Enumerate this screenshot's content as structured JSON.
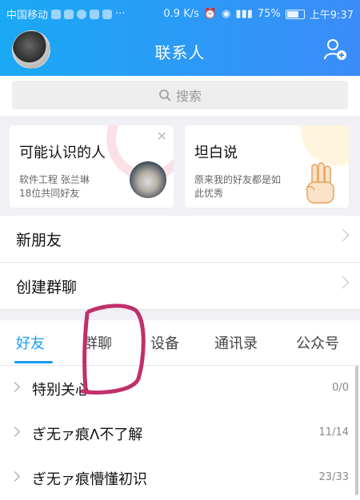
{
  "status_bar": {
    "carrier": "中国移动",
    "speed": "0.9 K/s",
    "battery": "75%",
    "time": "上午9:37"
  },
  "header": {
    "title": "联系人"
  },
  "search": {
    "placeholder": "搜索"
  },
  "cards": [
    {
      "title": "可能认识的人",
      "line1": "软件工程 张兰琳",
      "line2": "18位共同好友"
    },
    {
      "title": "坦白说",
      "line1": "原来我的好友都是如",
      "line2": "此优秀"
    }
  ],
  "menu": [
    {
      "label": "新朋友"
    },
    {
      "label": "创建群聊"
    }
  ],
  "tabs": [
    "好友",
    "群聊",
    "设备",
    "通讯录",
    "公众号"
  ],
  "groups": [
    {
      "name": "特别关心",
      "count": "0/0"
    },
    {
      "name": "ぎ无ァ痕Λ不了解",
      "count": "11/14"
    },
    {
      "name": "ぎ无ァ痕懵懂初识",
      "count": "23/33"
    }
  ],
  "colors": {
    "accent": "#1a9bf5",
    "header_start": "#1aa9f5",
    "header_end": "#3b8cf8",
    "annotation": "#c0306a"
  },
  "icons": {
    "search": "search-icon",
    "add_friend": "add-friend-icon",
    "close": "close-icon",
    "chevron": "chevron-right-icon"
  }
}
